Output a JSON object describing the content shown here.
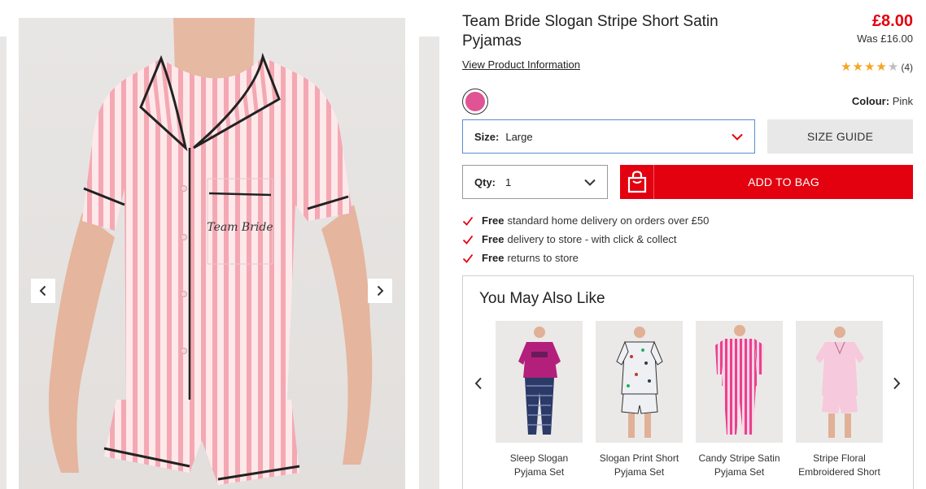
{
  "gallery": {
    "prev_icon": "chevron-left-icon",
    "next_icon": "chevron-right-icon",
    "pocket_text": "Team Bride"
  },
  "product": {
    "title": "Team Bride Slogan Stripe Short Satin Pyjamas",
    "price": "£8.00",
    "was_price": "Was £16.00",
    "view_info_link": "View Product Information",
    "rating_value": 4,
    "rating_max": 5,
    "rating_count": "(4)"
  },
  "colour": {
    "label": "Colour:",
    "value": "Pink",
    "swatch_color": "#e05394"
  },
  "size": {
    "label": "Size:",
    "value": "Large"
  },
  "size_guide": "SIZE GUIDE",
  "qty": {
    "label": "Qty:",
    "value": "1"
  },
  "add_to_bag": "ADD TO BAG",
  "benefits": [
    {
      "bold": "Free",
      "text": "standard home delivery on orders over £50"
    },
    {
      "bold": "Free",
      "text": "delivery to store - with click & collect"
    },
    {
      "bold": "Free",
      "text": "returns to store"
    }
  ],
  "recommendations": {
    "title": "You May Also Like",
    "items": [
      {
        "name": "Sleep Slogan Pyjama Set"
      },
      {
        "name": "Slogan Print Short Pyjama Set"
      },
      {
        "name": "Candy Stripe Satin Pyjama Set"
      },
      {
        "name": "Stripe Floral Embroidered Short"
      }
    ]
  },
  "colors": {
    "accent_red": "#e3000f",
    "star_gold": "#f5a623",
    "select_focus_border": "#5b8bd6"
  }
}
